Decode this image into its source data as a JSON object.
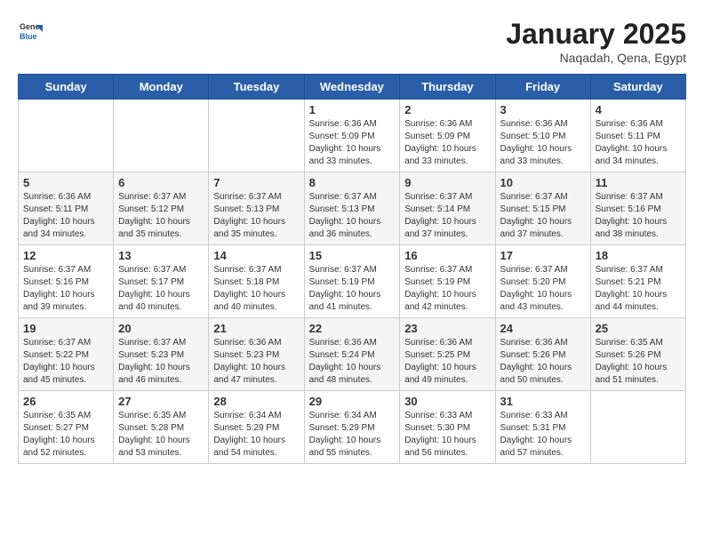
{
  "header": {
    "logo_general": "General",
    "logo_blue": "Blue",
    "month_title": "January 2025",
    "subtitle": "Naqadah, Qena, Egypt"
  },
  "days_of_week": [
    "Sunday",
    "Monday",
    "Tuesday",
    "Wednesday",
    "Thursday",
    "Friday",
    "Saturday"
  ],
  "weeks": [
    [
      {
        "day": "",
        "info": ""
      },
      {
        "day": "",
        "info": ""
      },
      {
        "day": "",
        "info": ""
      },
      {
        "day": "1",
        "info": "Sunrise: 6:36 AM\nSunset: 5:09 PM\nDaylight: 10 hours\nand 33 minutes."
      },
      {
        "day": "2",
        "info": "Sunrise: 6:36 AM\nSunset: 5:09 PM\nDaylight: 10 hours\nand 33 minutes."
      },
      {
        "day": "3",
        "info": "Sunrise: 6:36 AM\nSunset: 5:10 PM\nDaylight: 10 hours\nand 33 minutes."
      },
      {
        "day": "4",
        "info": "Sunrise: 6:36 AM\nSunset: 5:11 PM\nDaylight: 10 hours\nand 34 minutes."
      }
    ],
    [
      {
        "day": "5",
        "info": "Sunrise: 6:36 AM\nSunset: 5:11 PM\nDaylight: 10 hours\nand 34 minutes."
      },
      {
        "day": "6",
        "info": "Sunrise: 6:37 AM\nSunset: 5:12 PM\nDaylight: 10 hours\nand 35 minutes."
      },
      {
        "day": "7",
        "info": "Sunrise: 6:37 AM\nSunset: 5:13 PM\nDaylight: 10 hours\nand 35 minutes."
      },
      {
        "day": "8",
        "info": "Sunrise: 6:37 AM\nSunset: 5:13 PM\nDaylight: 10 hours\nand 36 minutes."
      },
      {
        "day": "9",
        "info": "Sunrise: 6:37 AM\nSunset: 5:14 PM\nDaylight: 10 hours\nand 37 minutes."
      },
      {
        "day": "10",
        "info": "Sunrise: 6:37 AM\nSunset: 5:15 PM\nDaylight: 10 hours\nand 37 minutes."
      },
      {
        "day": "11",
        "info": "Sunrise: 6:37 AM\nSunset: 5:16 PM\nDaylight: 10 hours\nand 38 minutes."
      }
    ],
    [
      {
        "day": "12",
        "info": "Sunrise: 6:37 AM\nSunset: 5:16 PM\nDaylight: 10 hours\nand 39 minutes."
      },
      {
        "day": "13",
        "info": "Sunrise: 6:37 AM\nSunset: 5:17 PM\nDaylight: 10 hours\nand 40 minutes."
      },
      {
        "day": "14",
        "info": "Sunrise: 6:37 AM\nSunset: 5:18 PM\nDaylight: 10 hours\nand 40 minutes."
      },
      {
        "day": "15",
        "info": "Sunrise: 6:37 AM\nSunset: 5:19 PM\nDaylight: 10 hours\nand 41 minutes."
      },
      {
        "day": "16",
        "info": "Sunrise: 6:37 AM\nSunset: 5:19 PM\nDaylight: 10 hours\nand 42 minutes."
      },
      {
        "day": "17",
        "info": "Sunrise: 6:37 AM\nSunset: 5:20 PM\nDaylight: 10 hours\nand 43 minutes."
      },
      {
        "day": "18",
        "info": "Sunrise: 6:37 AM\nSunset: 5:21 PM\nDaylight: 10 hours\nand 44 minutes."
      }
    ],
    [
      {
        "day": "19",
        "info": "Sunrise: 6:37 AM\nSunset: 5:22 PM\nDaylight: 10 hours\nand 45 minutes."
      },
      {
        "day": "20",
        "info": "Sunrise: 6:37 AM\nSunset: 5:23 PM\nDaylight: 10 hours\nand 46 minutes."
      },
      {
        "day": "21",
        "info": "Sunrise: 6:36 AM\nSunset: 5:23 PM\nDaylight: 10 hours\nand 47 minutes."
      },
      {
        "day": "22",
        "info": "Sunrise: 6:36 AM\nSunset: 5:24 PM\nDaylight: 10 hours\nand 48 minutes."
      },
      {
        "day": "23",
        "info": "Sunrise: 6:36 AM\nSunset: 5:25 PM\nDaylight: 10 hours\nand 49 minutes."
      },
      {
        "day": "24",
        "info": "Sunrise: 6:36 AM\nSunset: 5:26 PM\nDaylight: 10 hours\nand 50 minutes."
      },
      {
        "day": "25",
        "info": "Sunrise: 6:35 AM\nSunset: 5:26 PM\nDaylight: 10 hours\nand 51 minutes."
      }
    ],
    [
      {
        "day": "26",
        "info": "Sunrise: 6:35 AM\nSunset: 5:27 PM\nDaylight: 10 hours\nand 52 minutes."
      },
      {
        "day": "27",
        "info": "Sunrise: 6:35 AM\nSunset: 5:28 PM\nDaylight: 10 hours\nand 53 minutes."
      },
      {
        "day": "28",
        "info": "Sunrise: 6:34 AM\nSunset: 5:29 PM\nDaylight: 10 hours\nand 54 minutes."
      },
      {
        "day": "29",
        "info": "Sunrise: 6:34 AM\nSunset: 5:29 PM\nDaylight: 10 hours\nand 55 minutes."
      },
      {
        "day": "30",
        "info": "Sunrise: 6:33 AM\nSunset: 5:30 PM\nDaylight: 10 hours\nand 56 minutes."
      },
      {
        "day": "31",
        "info": "Sunrise: 6:33 AM\nSunset: 5:31 PM\nDaylight: 10 hours\nand 57 minutes."
      },
      {
        "day": "",
        "info": ""
      }
    ]
  ]
}
